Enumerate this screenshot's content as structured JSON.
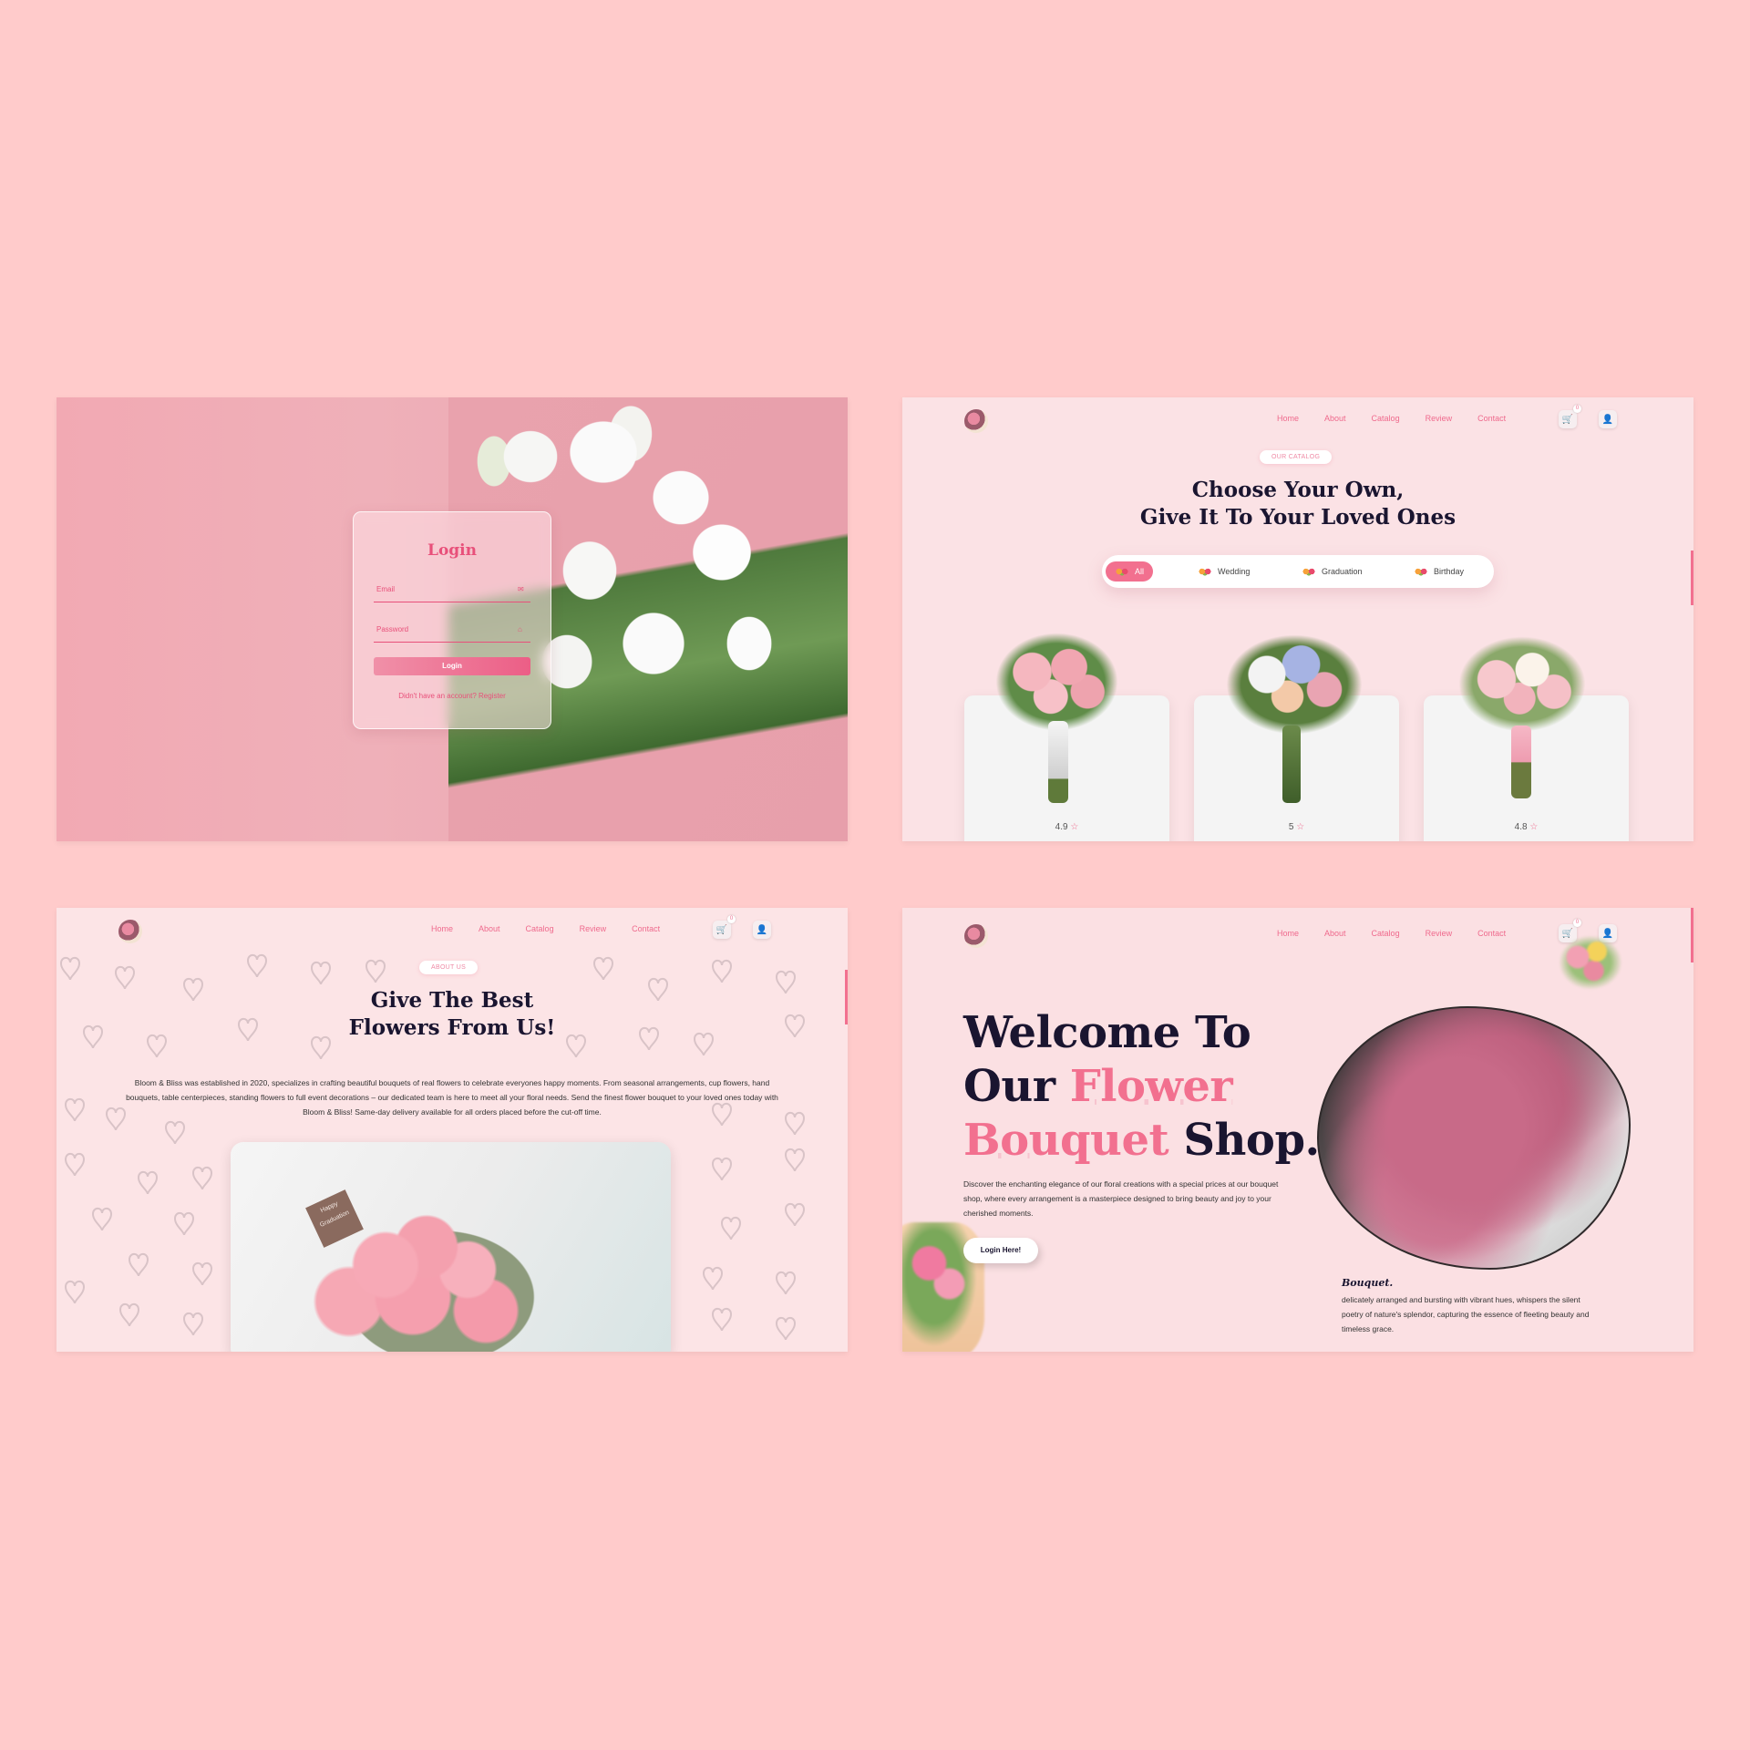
{
  "login": {
    "title": "Login",
    "email_label": "Email",
    "email_icon": "mail-icon",
    "password_label": "Password",
    "password_icon": "lock-icon",
    "button": "Login",
    "register_text": "Didn't have an account? Register"
  },
  "nav": {
    "items": [
      "Home",
      "About",
      "Catalog",
      "Review",
      "Contact"
    ],
    "cart_count": "0",
    "cart_icon": "cart-icon",
    "user_icon": "user-icon"
  },
  "catalog": {
    "eyebrow": "OUR CATALOG",
    "title_line1": "Choose Your Own,",
    "title_line2": "Give It To Your Loved Ones",
    "filters": [
      "All",
      "Wedding",
      "Graduation",
      "Birthday"
    ],
    "active_filter": "All",
    "products": [
      {
        "rating": "4.9"
      },
      {
        "rating": "5"
      },
      {
        "rating": "4.8"
      }
    ]
  },
  "about": {
    "eyebrow": "ABOUT US",
    "title_line1": "Give The Best",
    "title_line2": "Flowers From Us!",
    "text": "Bloom & Bliss was established in 2020, specializes in crafting beautiful bouquets of real flowers to celebrate everyones happy moments. From seasonal arrangements, cup flowers, hand bouquets, table centerpieces, standing flowers to full event decorations – our dedicated team is here to meet all your floral needs. Send the finest flower bouquet to your loved ones today with Bloom & Bliss! Same-day delivery available for all orders placed before the cut-off time.",
    "photo_tag": "Happy Graduation"
  },
  "home": {
    "title_line1": "Welcome To",
    "title_line2_a": "Our ",
    "title_line2_b": "Flower",
    "title_line3_a": "Bouquet",
    "title_line3_b": " Shop.",
    "description": "Discover the enchanting elegance of our floral creations with a special prices at our bouquet shop, where every arrangement is a masterpiece designed to bring beauty and joy to your cherished moments.",
    "button": "Login Here!",
    "caption_title": "Bouquet.",
    "caption_text": "delicately arranged and bursting with vibrant hues, whispers the silent poetry of nature's splendor, capturing the essence of fleeting beauty and timeless grace."
  },
  "colors": {
    "background": "#ffcbcb",
    "accent": "#f2708f",
    "heading": "#1a1530"
  }
}
